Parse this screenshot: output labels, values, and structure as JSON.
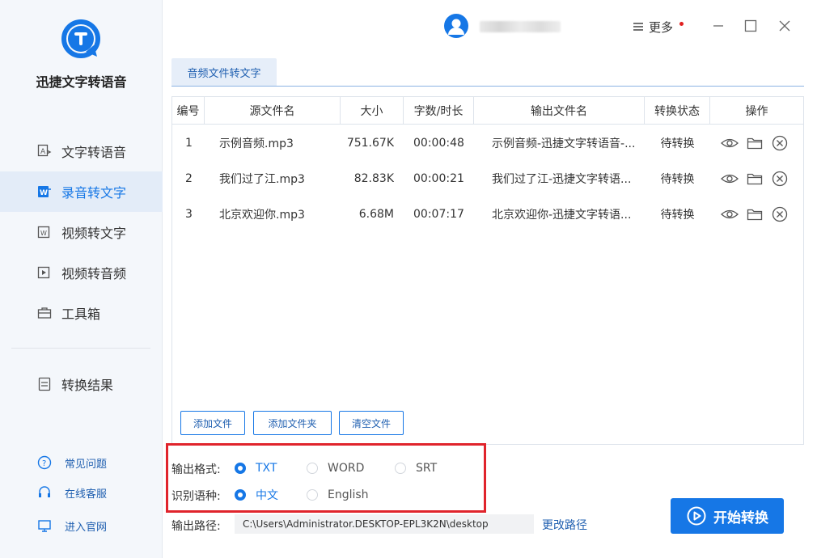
{
  "app": {
    "name": "迅捷文字转语音",
    "accent": "#1677e6"
  },
  "sidebar": {
    "items": [
      {
        "label": "文字转语音",
        "icon": "text-to-speech-icon",
        "active": false
      },
      {
        "label": "录音转文字",
        "icon": "audio-to-text-icon",
        "active": true
      },
      {
        "label": "视频转文字",
        "icon": "video-to-text-icon",
        "active": false
      },
      {
        "label": "视频转音频",
        "icon": "video-to-audio-icon",
        "active": false
      },
      {
        "label": "工具箱",
        "icon": "toolbox-icon",
        "active": false
      }
    ],
    "results_label": "转换结果",
    "footer": [
      {
        "label": "常见问题",
        "icon": "help-icon"
      },
      {
        "label": "在线客服",
        "icon": "headset-icon"
      },
      {
        "label": "进入官网",
        "icon": "website-icon"
      }
    ]
  },
  "titlebar": {
    "more_label": "更多"
  },
  "tab": {
    "label": "音频文件转文字"
  },
  "table": {
    "headers": [
      "编号",
      "源文件名",
      "大小",
      "字数/时长",
      "输出文件名",
      "转换状态",
      "操作"
    ],
    "rows": [
      {
        "index": "1",
        "source": "示例音频.mp3",
        "size": "751.67K",
        "duration": "00:00:48",
        "output": "示例音频-迅捷文字转语音-...",
        "status": "待转换"
      },
      {
        "index": "2",
        "source": "我们过了江.mp3",
        "size": "82.83K",
        "duration": "00:00:21",
        "output": "我们过了江-迅捷文字转语...",
        "status": "待转换"
      },
      {
        "index": "3",
        "source": "北京欢迎你.mp3",
        "size": "6.68M",
        "duration": "00:07:17",
        "output": "北京欢迎你-迅捷文字转语...",
        "status": "待转换"
      }
    ],
    "buttons": {
      "add_file": "添加文件",
      "add_folder": "添加文件夹",
      "clear": "清空文件"
    }
  },
  "options": {
    "format_label": "输出格式:",
    "formats": [
      "TXT",
      "WORD",
      "SRT"
    ],
    "selected_format": "TXT",
    "language_label": "识别语种:",
    "languages": [
      "中文",
      "English"
    ],
    "selected_language": "中文"
  },
  "output": {
    "path_label": "输出路径:",
    "path_value": "C:\\Users\\Administrator.DESKTOP-EPL3K2N\\desktop",
    "change_label": "更改路径"
  },
  "start_button": {
    "label": "开始转换"
  }
}
